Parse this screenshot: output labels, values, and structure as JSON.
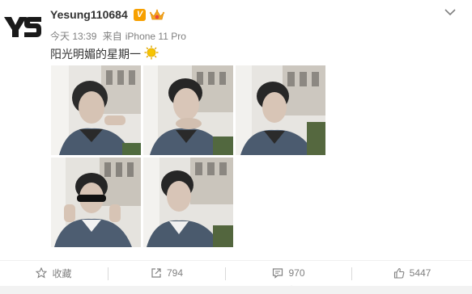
{
  "post": {
    "avatar_text": "YS",
    "username": "Yesung110684",
    "verified_badge": "V",
    "time": "今天 13:39",
    "source_prefix": "来自",
    "source_device": "iPhone 11 Pro",
    "content": "阳光明媚的星期一",
    "photos": [
      {
        "name": "photo-1",
        "icon": "image"
      },
      {
        "name": "photo-2",
        "icon": "image"
      },
      {
        "name": "photo-3",
        "icon": "image"
      },
      {
        "name": "photo-4",
        "icon": "image"
      },
      {
        "name": "photo-5",
        "icon": "image"
      }
    ]
  },
  "actions": {
    "favorite_label": "收藏",
    "repost_count": "794",
    "comment_count": "970",
    "like_count": "5447"
  },
  "colors": {
    "text": "#333333",
    "meta": "#808080",
    "badge": "#f7a000",
    "divider": "#d9d9d9"
  }
}
